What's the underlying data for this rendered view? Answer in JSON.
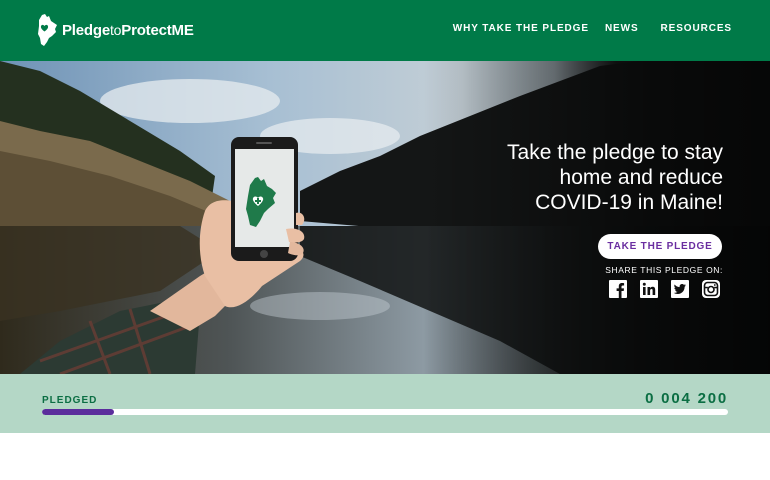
{
  "header": {
    "logo": {
      "part1": "Pledge",
      "part2": "to",
      "part3": "ProtectME"
    },
    "nav": [
      {
        "label": "WHY TAKE THE PLEDGE"
      },
      {
        "label": "NEWS"
      },
      {
        "label": "RESOURCES"
      }
    ]
  },
  "hero": {
    "title_line1": "Take the pledge to stay",
    "title_line2": "home and reduce",
    "title_line3": "COVID-19 in Maine!",
    "cta_label": "TAKE THE PLEDGE",
    "share_label": "SHARE THIS PLEDGE ON:",
    "social": [
      "facebook-icon",
      "linkedin-icon",
      "twitter-icon",
      "instagram-icon"
    ]
  },
  "progress": {
    "label": "PLEDGED",
    "count": "0 004 200",
    "fill_fraction": 0.105
  },
  "colors": {
    "header_green": "#007a48",
    "band_green": "#b4d7c6",
    "progress_purple": "#5b2d9c",
    "cta_text_purple": "#6a2ea0"
  }
}
